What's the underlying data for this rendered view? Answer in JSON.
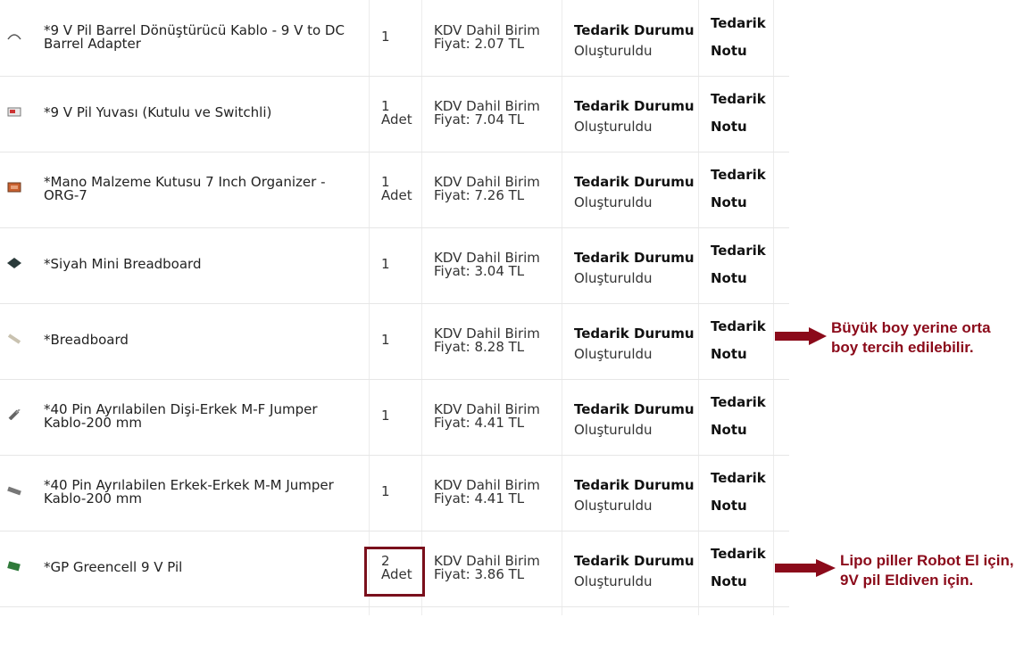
{
  "columns": {
    "status_title": "Tedarik Durumu",
    "note_title_line1": "Tedarik",
    "note_title_line2": "Notu"
  },
  "rows": [
    {
      "name": "*9 V Pil Barrel Dönüştürücü Kablo - 9 V to DC Barrel Adapter",
      "qty": "1",
      "price": "KDV Dahil Birim Fiyat: 2.07 TL",
      "status": "Oluşturuldu",
      "thumb_icon": "barrel-cable-icon"
    },
    {
      "name": "*9 V Pil Yuvası (Kutulu ve Switchli)",
      "qty": "1 Adet",
      "price": "KDV Dahil Birim Fiyat: 7.04 TL",
      "status": "Oluşturuldu",
      "thumb_icon": "battery-holder-icon"
    },
    {
      "name": "*Mano Malzeme Kutusu 7 Inch Organizer - ORG-7",
      "qty": "1 Adet",
      "price": "KDV Dahil Birim Fiyat: 7.26 TL",
      "status": "Oluşturuldu",
      "thumb_icon": "organizer-box-icon"
    },
    {
      "name": "*Siyah Mini Breadboard",
      "qty": "1",
      "price": "KDV Dahil Birim Fiyat: 3.04 TL",
      "status": "Oluşturuldu",
      "thumb_icon": "mini-breadboard-icon"
    },
    {
      "name": "*Breadboard",
      "qty": "1",
      "price": "KDV Dahil Birim Fiyat: 8.28 TL",
      "status": "Oluşturuldu",
      "thumb_icon": "breadboard-icon"
    },
    {
      "name": "*40 Pin Ayrılabilen Dişi-Erkek M-F Jumper Kablo-200 mm",
      "qty": "1",
      "price": "KDV Dahil Birim Fiyat: 4.41 TL",
      "status": "Oluşturuldu",
      "thumb_icon": "jumper-cable-icon"
    },
    {
      "name": "*40 Pin Ayrılabilen Erkek-Erkek M-M Jumper Kablo-200 mm",
      "qty": "1",
      "price": "KDV Dahil Birim Fiyat: 4.41 TL",
      "status": "Oluşturuldu",
      "thumb_icon": "jumper-cable-icon"
    },
    {
      "name": "*GP Greencell 9 V Pil",
      "qty": "2 Adet",
      "price": "KDV Dahil Birim Fiyat: 3.86 TL",
      "status": "Oluşturuldu",
      "thumb_icon": "battery-icon"
    }
  ],
  "annotations": [
    {
      "text": "Büyük boy yerine orta boy tercih edilebilir.",
      "line1": "Büyük boy yerine orta",
      "line2": "boy tercih edilebilir."
    },
    {
      "text": "Lipo piller Robot El için, 9V pil Eldiven için.",
      "line1": "Lipo piller Robot El için,",
      "line2": "9V pil Eldiven için."
    }
  ],
  "colors": {
    "annotation": "#8b0a1a",
    "highlight": "#7a0f1c"
  }
}
